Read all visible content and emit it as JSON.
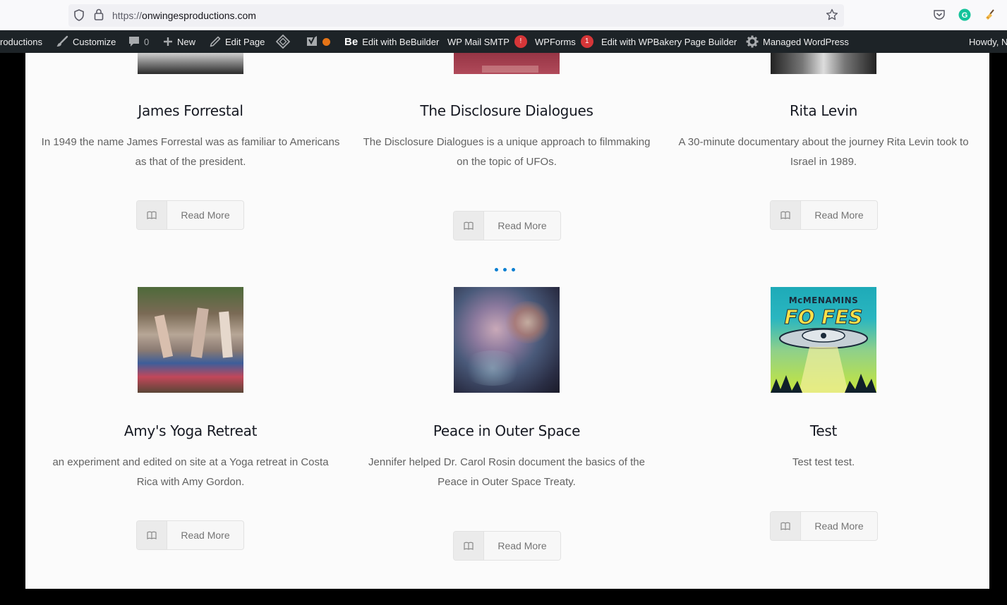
{
  "browser": {
    "url_protocol": "https://",
    "url_host": "onwingesproductions.com",
    "icons": [
      "shield-icon",
      "lock-icon",
      "star-icon",
      "pocket-icon",
      "grammarly-icon",
      "broom-icon"
    ]
  },
  "adminbar": {
    "site_name": "roductions",
    "customize": "Customize",
    "comments_count": "0",
    "new": "New",
    "edit_page": "Edit Page",
    "bebuilder_logo": "Be",
    "edit_bebuilder": "Edit with BeBuilder",
    "wp_mail_smtp": "WP Mail SMTP",
    "wp_mail_badge": "!",
    "wpforms": "WPForms",
    "wpforms_badge": "1",
    "wpbakery": "Edit with WPBakery Page Builder",
    "managed_wp": "Managed WordPress",
    "howdy": "Howdy, N"
  },
  "colors": {
    "adminbar_bg": "#1d2327",
    "badge": "#d63638",
    "loader": "#0a7fd1",
    "page_bg": "#fbfbfb"
  },
  "cards": [
    {
      "title": "James Forrestal",
      "desc": "In 1949 the name James Forrestal was as familiar to Americans as that of the president.",
      "button": "Read More"
    },
    {
      "title": "The Disclosure Dialogues",
      "desc": "The Disclosure Dialogues is a unique approach to filmmaking on the topic of UFOs.",
      "button": "Read More"
    },
    {
      "title": "Rita Levin",
      "desc": "A 30-minute documentary about the journey Rita Levin took to Israel in 1989.",
      "button": "Read More"
    },
    {
      "title": "Amy's Yoga Retreat",
      "desc": "an experiment and edited on site at a Yoga retreat in Costa Rica with Amy Gordon.",
      "button": "Read More"
    },
    {
      "title": "Peace in Outer Space",
      "desc": "Jennifer helped Dr. Carol Rosin document the basics of the Peace in Outer Space Treaty.",
      "button": "Read More"
    },
    {
      "title": "Test",
      "desc": "Test test test.",
      "button": "Read More"
    }
  ],
  "poster": {
    "line1": "McMENAMINS",
    "line2": "FO FES"
  }
}
